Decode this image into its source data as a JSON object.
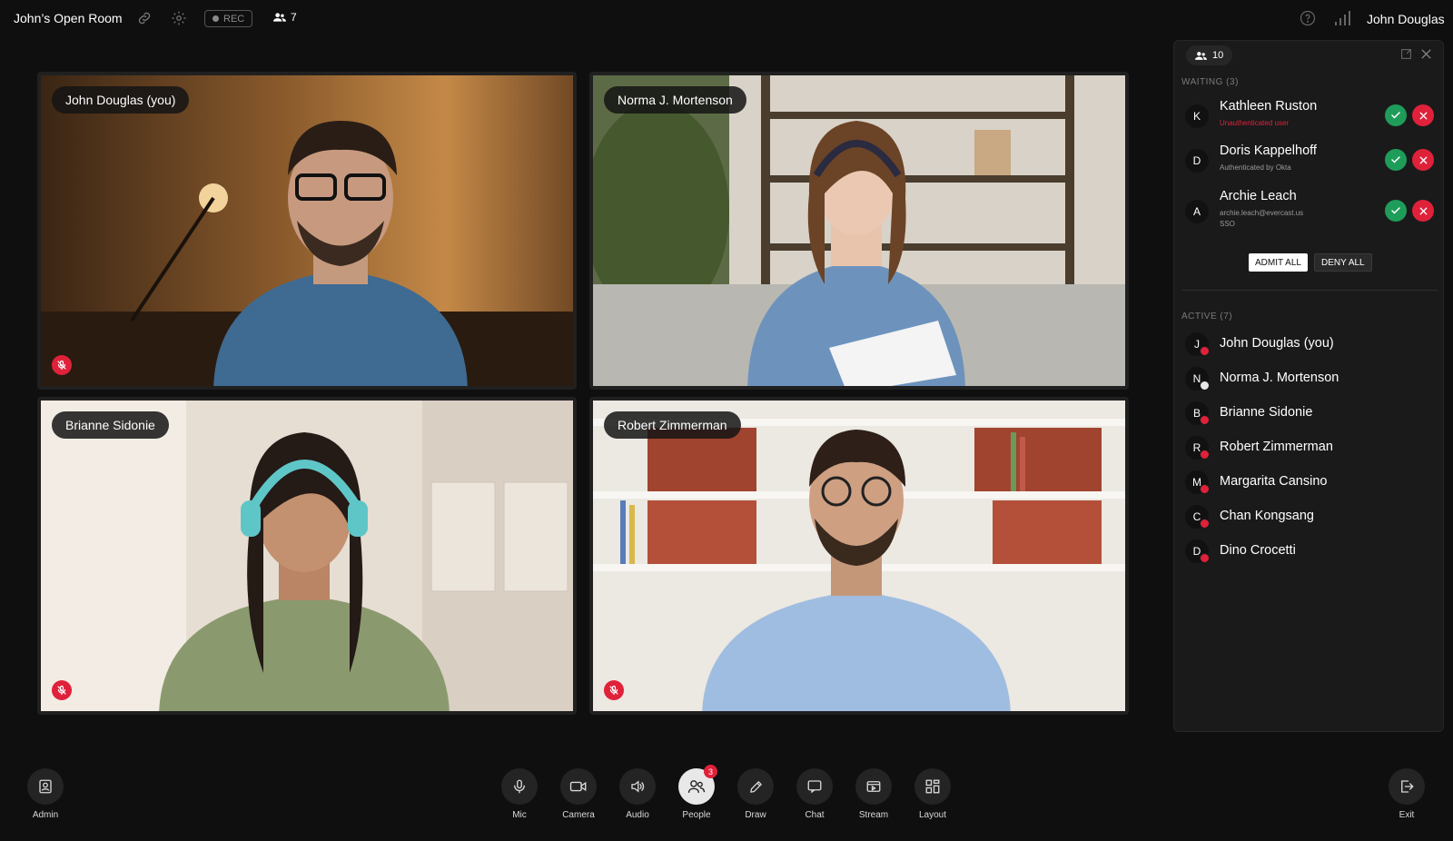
{
  "header": {
    "room_title": "John’s Open Room",
    "rec_label": "REC",
    "participant_count": "7",
    "user_name": "John Douglas"
  },
  "tiles": [
    {
      "name": "John Douglas (you)",
      "muted": true
    },
    {
      "name": "Norma J. Mortenson",
      "muted": false
    },
    {
      "name": "Brianne Sidonie",
      "muted": true
    },
    {
      "name": "Robert Zimmerman",
      "muted": true
    }
  ],
  "panel": {
    "count": "10",
    "waiting_label": "WAITING (3)",
    "waiting": [
      {
        "initial": "K",
        "name": "Kathleen Ruston",
        "sub": "Unauthenticated user",
        "sub2": ""
      },
      {
        "initial": "D",
        "name": "Doris Kappelhoff",
        "sub": "Authenticated by Okta",
        "sub2": ""
      },
      {
        "initial": "A",
        "name": "Archie Leach",
        "sub": "archie.leach@evercast.us",
        "sub2": "SSO"
      }
    ],
    "admit_all_label": "ADMIT ALL",
    "deny_all_label": "DENY ALL",
    "active_label": "ACTIVE (7)",
    "active": [
      {
        "initial": "J",
        "name": "John Douglas (you)"
      },
      {
        "initial": "N",
        "name": "Norma J. Mortenson"
      },
      {
        "initial": "B",
        "name": "Brianne Sidonie"
      },
      {
        "initial": "R",
        "name": "Robert Zimmerman"
      },
      {
        "initial": "M",
        "name": "Margarita Cansino"
      },
      {
        "initial": "C",
        "name": "Chan Kongsang"
      },
      {
        "initial": "D",
        "name": "Dino Crocetti"
      }
    ]
  },
  "toolbar": {
    "admin": "Admin",
    "mic": "Mic",
    "camera": "Camera",
    "audio": "Audio",
    "people": "People",
    "people_badge": "3",
    "draw": "Draw",
    "chat": "Chat",
    "stream": "Stream",
    "layout": "Layout",
    "exit": "Exit"
  },
  "colors": {
    "background": "#0f0f0f",
    "panel": "#1a1a1a",
    "danger": "#e0213a",
    "success": "#1e9d5a"
  }
}
